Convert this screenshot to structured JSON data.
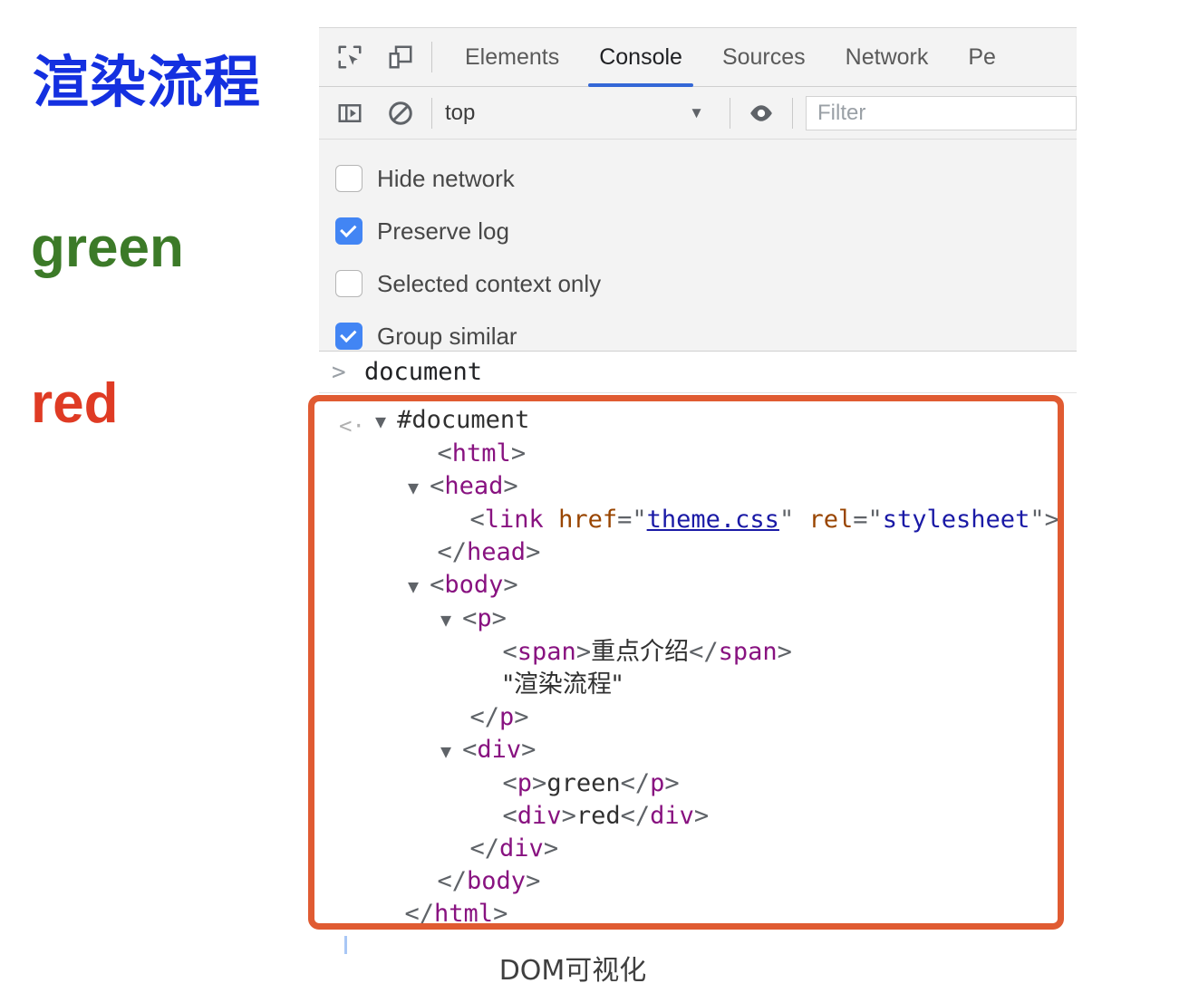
{
  "page": {
    "title_cn": "渲染流程",
    "green_text": "green",
    "red_text": "red",
    "caption": "DOM可视化",
    "colors": {
      "title_blue": "#1430e0",
      "green": "#3c7a28",
      "red": "#df3b24",
      "highlight_orange": "#e05b32",
      "active_tab_blue": "#3367d6",
      "checkbox_blue": "#4285f4"
    }
  },
  "devtools": {
    "toolbar_icons": [
      {
        "name": "inspect-element-icon",
        "label": "Inspect element"
      },
      {
        "name": "device-toolbar-icon",
        "label": "Toggle device toolbar"
      }
    ],
    "tabs": [
      {
        "label": "Elements",
        "active": false
      },
      {
        "label": "Console",
        "active": true
      },
      {
        "label": "Sources",
        "active": false
      },
      {
        "label": "Network",
        "active": false
      },
      {
        "label": "Pe",
        "active": false
      }
    ],
    "filterbar": {
      "sidebar_toggle_icon": "console-sidebar-icon",
      "clear_console_icon": "clear-console-icon",
      "context_value": "top",
      "caret": "▼",
      "eye_icon": "eye-icon",
      "filter_placeholder": "Filter"
    },
    "checkboxes": [
      {
        "label": "Hide network",
        "checked": false
      },
      {
        "label": "Preserve log",
        "checked": true
      },
      {
        "label": "Selected context only",
        "checked": false
      },
      {
        "label": "Group similar",
        "checked": true
      }
    ],
    "console": {
      "prompt_symbol": ">",
      "command": "document",
      "result_symbol": "<·",
      "dom_tree": [
        {
          "indent": 0,
          "triangle": "▼",
          "parts": [
            {
              "t": "hash",
              "v": "#document"
            }
          ]
        },
        {
          "indent": 1,
          "triangle": "",
          "parts": [
            {
              "t": "br",
              "v": "<"
            },
            {
              "t": "tag",
              "v": "html"
            },
            {
              "t": "br",
              "v": ">"
            }
          ]
        },
        {
          "indent": 1,
          "triangle": "▼",
          "parts": [
            {
              "t": "br",
              "v": "<"
            },
            {
              "t": "tag",
              "v": "head"
            },
            {
              "t": "br",
              "v": ">"
            }
          ]
        },
        {
          "indent": 2,
          "triangle": "",
          "parts": [
            {
              "t": "br",
              "v": "<"
            },
            {
              "t": "tag",
              "v": "link"
            },
            {
              "t": "sp",
              "v": " "
            },
            {
              "t": "attr",
              "v": "href"
            },
            {
              "t": "br",
              "v": "=\""
            },
            {
              "t": "link",
              "v": "theme.css"
            },
            {
              "t": "br",
              "v": "\""
            },
            {
              "t": "sp",
              "v": " "
            },
            {
              "t": "attr",
              "v": "rel"
            },
            {
              "t": "br",
              "v": "=\""
            },
            {
              "t": "val",
              "v": "stylesheet"
            },
            {
              "t": "br",
              "v": "\">"
            }
          ]
        },
        {
          "indent": 1,
          "triangle": "",
          "parts": [
            {
              "t": "br",
              "v": "</"
            },
            {
              "t": "tag",
              "v": "head"
            },
            {
              "t": "br",
              "v": ">"
            }
          ]
        },
        {
          "indent": 1,
          "triangle": "▼",
          "parts": [
            {
              "t": "br",
              "v": "<"
            },
            {
              "t": "tag",
              "v": "body"
            },
            {
              "t": "br",
              "v": ">"
            }
          ]
        },
        {
          "indent": 2,
          "triangle": "▼",
          "parts": [
            {
              "t": "br",
              "v": "<"
            },
            {
              "t": "tag",
              "v": "p"
            },
            {
              "t": "br",
              "v": ">"
            }
          ]
        },
        {
          "indent": 3,
          "triangle": "",
          "parts": [
            {
              "t": "br",
              "v": "<"
            },
            {
              "t": "tag",
              "v": "span"
            },
            {
              "t": "br",
              "v": ">"
            },
            {
              "t": "cjk",
              "v": "重点介绍"
            },
            {
              "t": "br",
              "v": "</"
            },
            {
              "t": "tag",
              "v": "span"
            },
            {
              "t": "br",
              "v": ">"
            }
          ]
        },
        {
          "indent": 3,
          "triangle": "",
          "parts": [
            {
              "t": "cjk",
              "v": "\"渲染流程\""
            }
          ]
        },
        {
          "indent": 2,
          "triangle": "",
          "parts": [
            {
              "t": "br",
              "v": "</"
            },
            {
              "t": "tag",
              "v": "p"
            },
            {
              "t": "br",
              "v": ">"
            }
          ]
        },
        {
          "indent": 2,
          "triangle": "▼",
          "parts": [
            {
              "t": "br",
              "v": "<"
            },
            {
              "t": "tag",
              "v": "div"
            },
            {
              "t": "br",
              "v": ">"
            }
          ]
        },
        {
          "indent": 3,
          "triangle": "",
          "parts": [
            {
              "t": "br",
              "v": "<"
            },
            {
              "t": "tag",
              "v": "p"
            },
            {
              "t": "br",
              "v": ">"
            },
            {
              "t": "text",
              "v": "green"
            },
            {
              "t": "br",
              "v": "</"
            },
            {
              "t": "tag",
              "v": "p"
            },
            {
              "t": "br",
              "v": ">"
            }
          ]
        },
        {
          "indent": 3,
          "triangle": "",
          "parts": [
            {
              "t": "br",
              "v": "<"
            },
            {
              "t": "tag",
              "v": "div"
            },
            {
              "t": "br",
              "v": ">"
            },
            {
              "t": "text",
              "v": "red"
            },
            {
              "t": "br",
              "v": "</"
            },
            {
              "t": "tag",
              "v": "div"
            },
            {
              "t": "br",
              "v": ">"
            }
          ]
        },
        {
          "indent": 2,
          "triangle": "",
          "parts": [
            {
              "t": "br",
              "v": "</"
            },
            {
              "t": "tag",
              "v": "div"
            },
            {
              "t": "br",
              "v": ">"
            }
          ]
        },
        {
          "indent": 1,
          "triangle": "",
          "parts": [
            {
              "t": "br",
              "v": "</"
            },
            {
              "t": "tag",
              "v": "body"
            },
            {
              "t": "br",
              "v": ">"
            }
          ]
        },
        {
          "indent": 0,
          "triangle": "",
          "parts": [
            {
              "t": "br",
              "v": "</"
            },
            {
              "t": "tag",
              "v": "html"
            },
            {
              "t": "br",
              "v": ">"
            }
          ]
        }
      ]
    }
  }
}
